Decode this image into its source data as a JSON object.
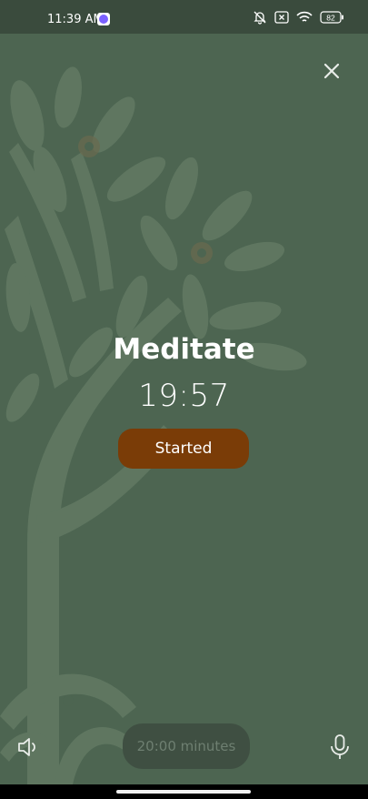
{
  "status_bar": {
    "time": "11:39 AM",
    "battery": "82"
  },
  "icons": {
    "close": "close-icon",
    "sound": "speaker-icon",
    "mic": "microphone-icon",
    "mute": "bell-off-icon",
    "wifi": "wifi-icon",
    "sim": "sim-x-icon",
    "battery": "battery-icon"
  },
  "session": {
    "title": "Meditate",
    "timer": "19:57",
    "status_button": "Started"
  },
  "footer": {
    "duration_label": "20:00 minutes"
  },
  "colors": {
    "background": "#4d6551",
    "status_bar": "#3a4b3d",
    "started_button": "#7a3c07",
    "duration_pill": "#3f4f42"
  }
}
